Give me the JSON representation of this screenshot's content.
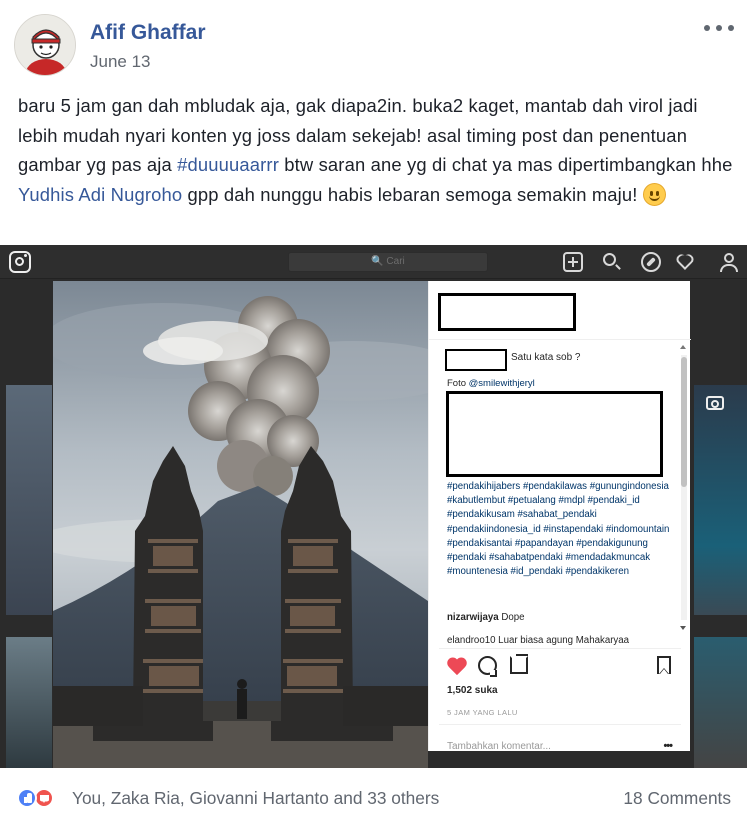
{
  "post": {
    "author": "Afif Ghaffar",
    "date": "June 13",
    "text_part1": "baru 5 jam gan dah mbludak aja, gak diapa2in. buka2 kaget, mantab dah virol jadi lebih mudah nyari konten yg joss dalam sekejab! asal timing post dan penentuan gambar yg pas aja ",
    "hashtag": "#duuuuaarrr",
    "text_part2": " btw saran ane yg di chat ya mas dipertimbangkan hhe ",
    "mention": "Yudhis Adi Nugroho",
    "text_part3": " gpp dah nunggu habis lebaran semoga semakin maju! ",
    "emoji": "slightly-smiling-face-icon"
  },
  "screenshot": {
    "search_placeholder": "🔍 Cari",
    "caption_question": "Satu kata sob ?",
    "caption_photo_prefix": "Foto ",
    "caption_photo_user": "@smilewithjeryl",
    "hashtags": "#pendakihijabers #pendakilawas #gunungindonesia #kabutlembut #petualang #mdpl #pendaki_id #pendakikusam #sahabat_pendaki #pendakiindonesia_id #instapendaki #indomountain #pendakisantai #papandayan #pendakigunung #pendaki #sahabatpendaki #mendadakmuncak #mountenesia #id_pendaki #pendakikeren",
    "comment1_user": "nizarwijaya",
    "comment1_text": " Dope",
    "comment2_user": "elandroo10",
    "comment2_text": " Luar biasa agung Mahakaryaa",
    "likes": "1,502 suka",
    "time": "5 JAM YANG LALU",
    "add_comment_placeholder": "Tambahkan komentar...",
    "more_glyph": "•••"
  },
  "footer": {
    "reactions_text": "You, Zaka Ria, Giovanni Hartanto and 33 others",
    "comments_count": "18 Comments"
  },
  "colors": {
    "link": "#365899",
    "like_red": "#ed4956",
    "fb_blue": "#4e80f6",
    "love_red": "#f0544f"
  }
}
